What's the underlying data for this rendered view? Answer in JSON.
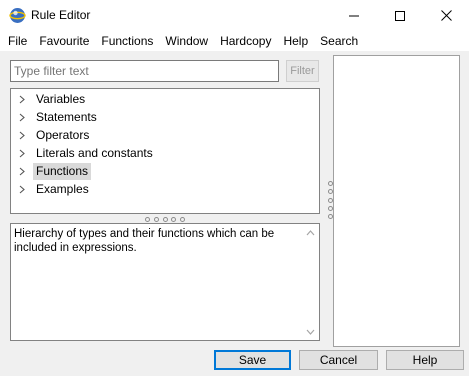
{
  "window": {
    "title": "Rule Editor",
    "icon": "eclipse-globe-icon"
  },
  "window_controls": [
    "minimize-icon",
    "maximize-icon",
    "close-icon"
  ],
  "menu": [
    "File",
    "Favourite",
    "Functions",
    "Window",
    "Hardcopy",
    "Help",
    "Search"
  ],
  "filter": {
    "placeholder": "Type filter text",
    "button": "Filter"
  },
  "tree": {
    "items": [
      {
        "label": "Variables",
        "selected": false
      },
      {
        "label": "Statements",
        "selected": false
      },
      {
        "label": "Operators",
        "selected": false
      },
      {
        "label": "Literals and constants",
        "selected": false
      },
      {
        "label": "Functions",
        "selected": true
      },
      {
        "label": "Examples",
        "selected": false
      }
    ]
  },
  "description": {
    "text": "Hierarchy of types and their functions which can be included in expressions."
  },
  "buttons": {
    "save": "Save",
    "cancel": "Cancel",
    "help": "Help"
  },
  "colors": {
    "default_button_border": "#0078d7",
    "selection": "#d9d9d9",
    "disabled_text": "#9a9a9a"
  }
}
